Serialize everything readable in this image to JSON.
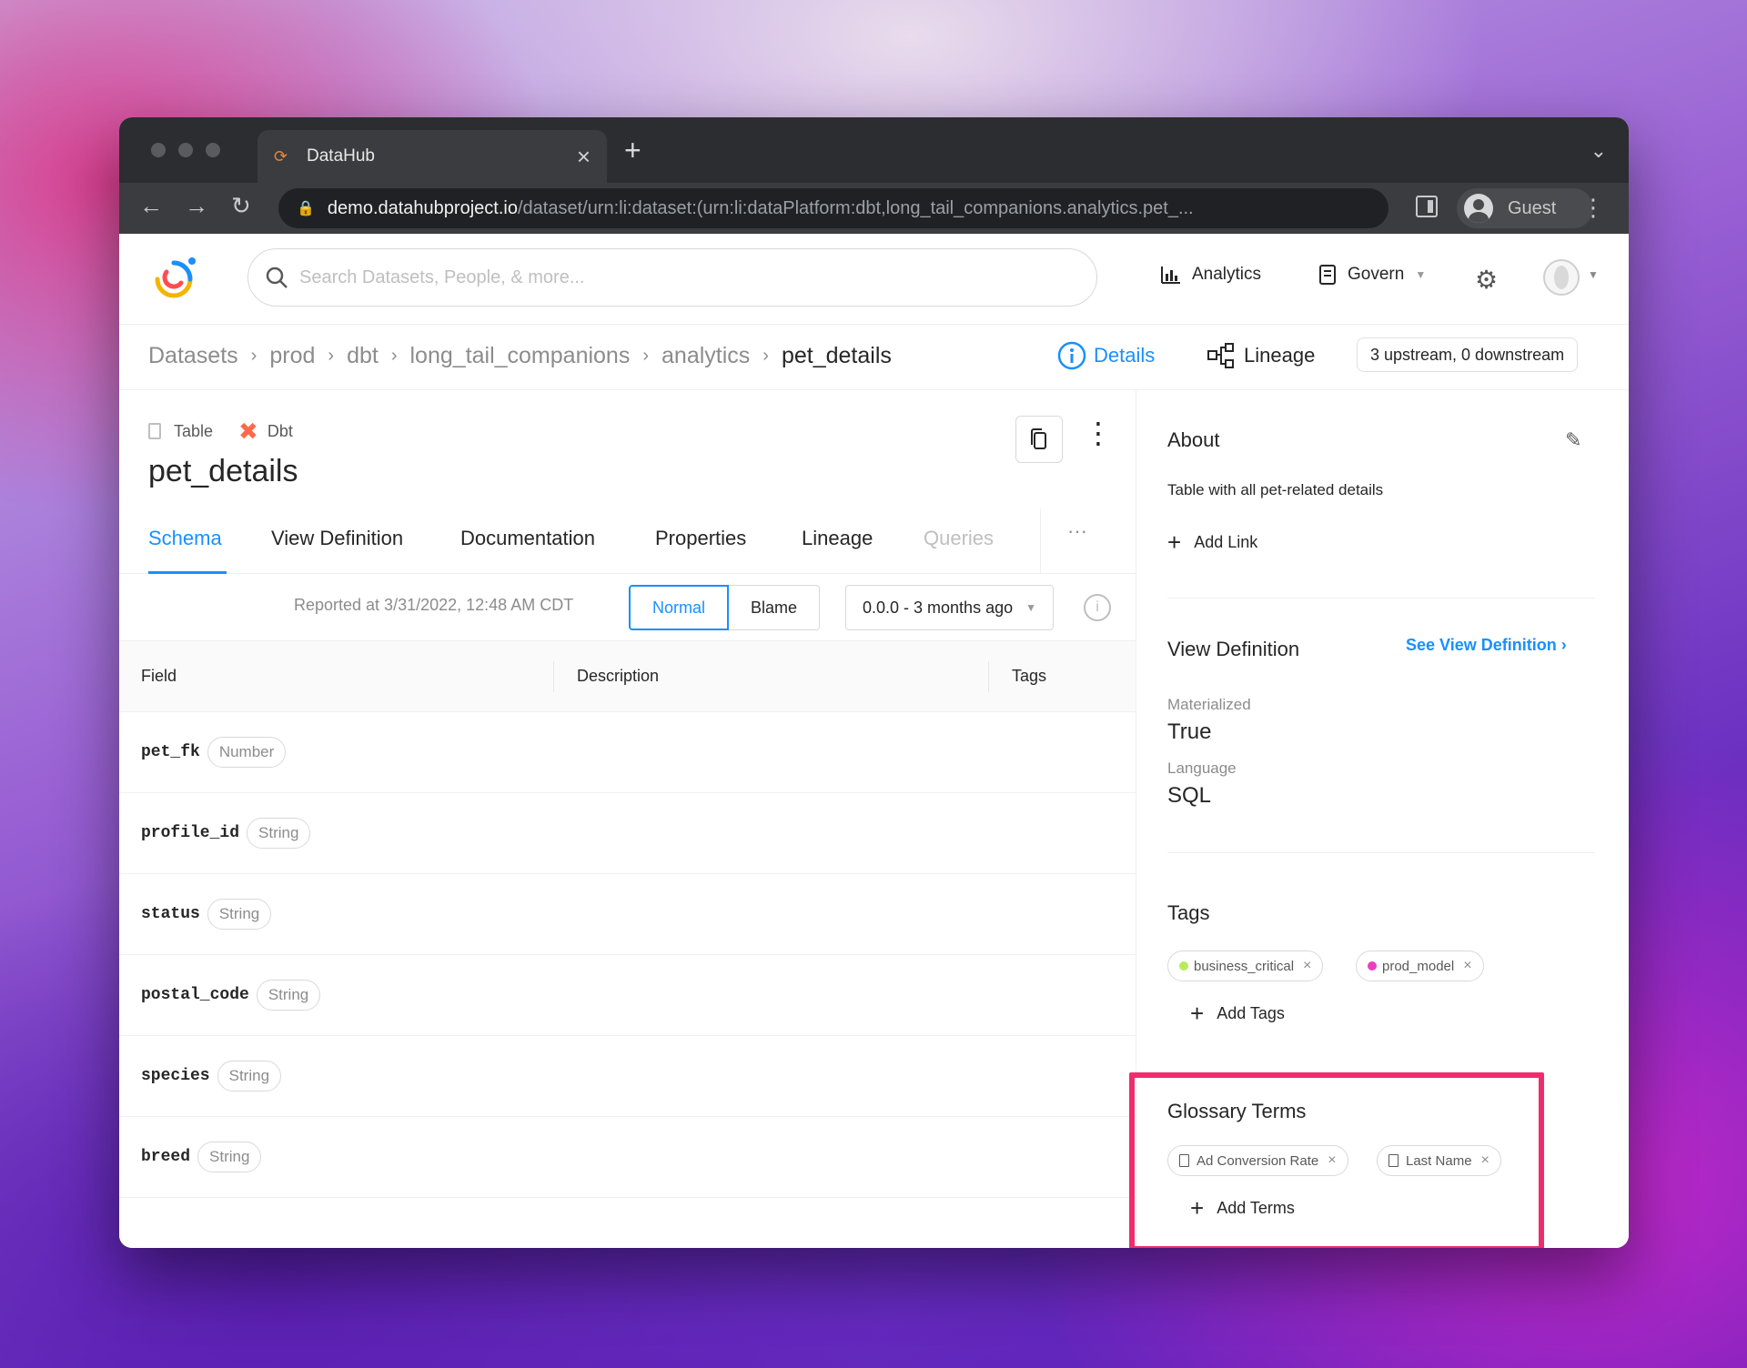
{
  "browser": {
    "tab_title": "DataHub",
    "url_host": "demo.datahubproject.io",
    "url_path": "/dataset/urn:li:dataset:(urn:li:dataPlatform:dbt,long_tail_companions.analytics.pet_...",
    "profile_label": "Guest"
  },
  "header": {
    "search_placeholder": "Search Datasets, People, & more...",
    "analytics_label": "Analytics",
    "govern_label": "Govern"
  },
  "breadcrumbs": [
    "Datasets",
    "prod",
    "dbt",
    "long_tail_companions",
    "analytics",
    "pet_details"
  ],
  "view_switch": {
    "details_label": "Details",
    "lineage_label": "Lineage",
    "lineage_counts": "3 upstream, 0 downstream"
  },
  "entity": {
    "type_label": "Table",
    "platform_label": "Dbt",
    "name": "pet_details"
  },
  "tabs": [
    "Schema",
    "View Definition",
    "Documentation",
    "Properties",
    "Lineage",
    "Queries"
  ],
  "schema": {
    "reported": "Reported at 3/31/2022, 12:48 AM CDT",
    "mode_normal": "Normal",
    "mode_blame": "Blame",
    "version": "0.0.0 - 3 months ago",
    "columns": [
      "Field",
      "Description",
      "Tags"
    ],
    "rows": [
      {
        "field": "pet_fk",
        "type": "Number"
      },
      {
        "field": "profile_id",
        "type": "String"
      },
      {
        "field": "status",
        "type": "String"
      },
      {
        "field": "postal_code",
        "type": "String"
      },
      {
        "field": "species",
        "type": "String"
      },
      {
        "field": "breed",
        "type": "String"
      }
    ]
  },
  "sidebar": {
    "about_title": "About",
    "about_desc": "Table with all pet-related details",
    "add_link": "Add Link",
    "view_def_title": "View Definition",
    "see_view_def": "See View Definition ›",
    "materialized_label": "Materialized",
    "materialized_value": "True",
    "language_label": "Language",
    "language_value": "SQL",
    "tags_title": "Tags",
    "tags": [
      {
        "name": "business_critical",
        "color": "#b7eb5a"
      },
      {
        "name": "prod_model",
        "color": "#e83fbf"
      }
    ],
    "add_tags": "Add Tags",
    "glossary_title": "Glossary Terms",
    "terms": [
      "Ad Conversion Rate",
      "Last Name"
    ],
    "add_terms": "Add Terms"
  },
  "colors": {
    "accent": "#1890ff",
    "highlight": "#ee2d6e"
  }
}
